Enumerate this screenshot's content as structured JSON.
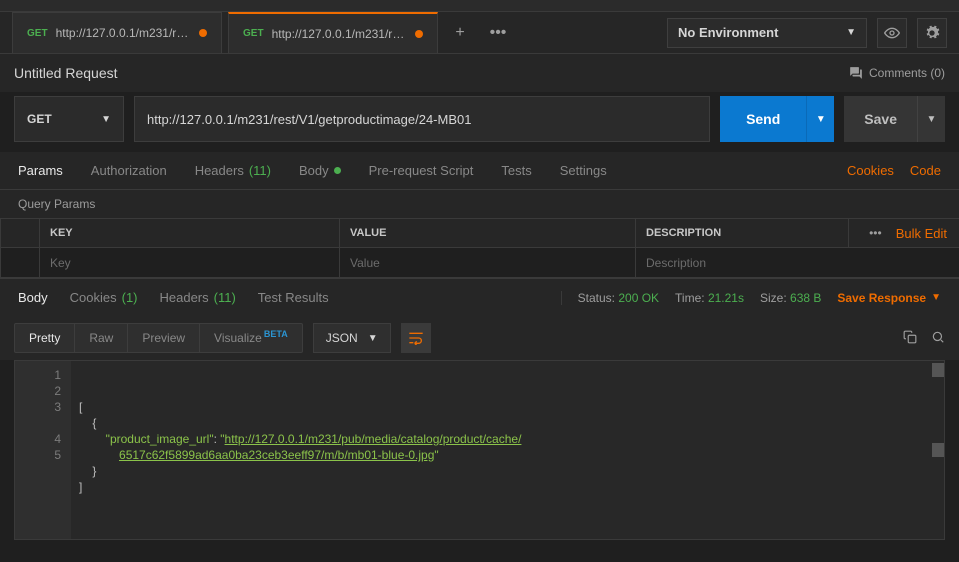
{
  "tabs": [
    {
      "method": "GET",
      "title": "http://127.0.0.1/m231/rest/V1/...",
      "dirty": true
    },
    {
      "method": "GET",
      "title": "http://127.0.0.1/m231/rest/V1/...",
      "dirty": true,
      "active": true
    }
  ],
  "environment": {
    "selected": "No Environment"
  },
  "request": {
    "title": "Untitled Request",
    "commentsLabel": "Comments (0)",
    "method": "GET",
    "url": "http://127.0.0.1/m231/rest/V1/getproductimage/24-MB01",
    "sendLabel": "Send",
    "saveLabel": "Save"
  },
  "reqTabs": {
    "params": "Params",
    "authorization": "Authorization",
    "headers": "Headers",
    "headersCount": "(11)",
    "body": "Body",
    "prereq": "Pre-request Script",
    "tests": "Tests",
    "settings": "Settings",
    "cookiesLink": "Cookies",
    "codeLink": "Code"
  },
  "paramsTable": {
    "title": "Query Params",
    "headers": {
      "key": "KEY",
      "value": "VALUE",
      "description": "DESCRIPTION"
    },
    "bulkEdit": "Bulk Edit",
    "placeholders": {
      "key": "Key",
      "value": "Value",
      "description": "Description"
    }
  },
  "respTabs": {
    "body": "Body",
    "cookies": "Cookies",
    "cookiesCount": "(1)",
    "headers": "Headers",
    "headersCount": "(11)",
    "testResults": "Test Results"
  },
  "respMeta": {
    "statusLabel": "Status:",
    "statusValue": "200 OK",
    "timeLabel": "Time:",
    "timeValue": "21.21s",
    "sizeLabel": "Size:",
    "sizeValue": "638 B",
    "saveResponse": "Save Response"
  },
  "viewModes": {
    "pretty": "Pretty",
    "raw": "Raw",
    "preview": "Preview",
    "visualize": "Visualize",
    "beta": "BETA",
    "contentType": "JSON"
  },
  "responseBody": {
    "lineNumbers": [
      "1",
      "2",
      "3",
      "4",
      "5"
    ],
    "open": "[",
    "objOpen": "    {",
    "keyQuote": "\"",
    "key": "product_image_url",
    "colon": ": ",
    "valQuote": "\"",
    "urlLine1": "http://127.0.0.1/m231/pub/media/catalog/product/cache/",
    "urlLine2": "6517c62f5899ad6aa0ba23ceb3eeff97/m/b/mb01-blue-0.jpg",
    "objClose": "    }",
    "close": "]"
  }
}
